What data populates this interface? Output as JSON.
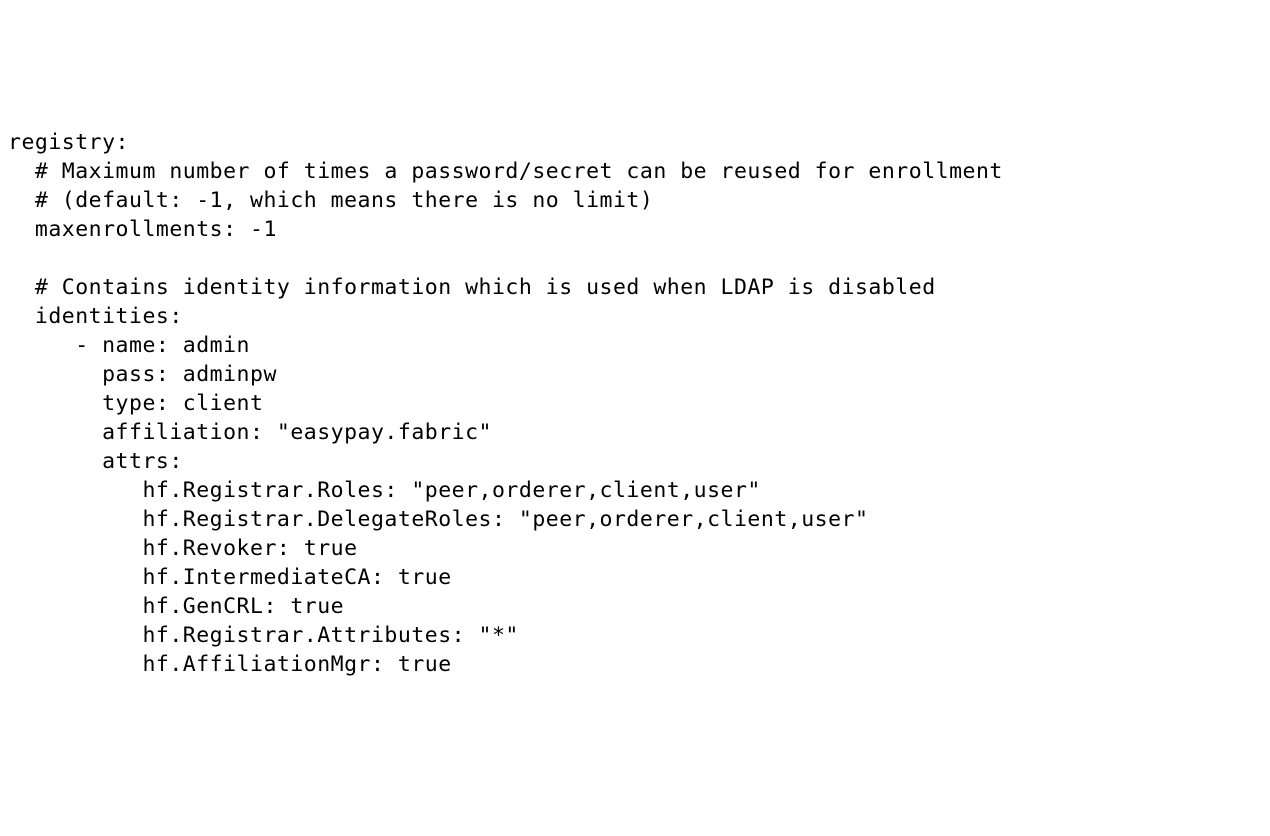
{
  "lines": {
    "l1": "registry:",
    "l2": "  # Maximum number of times a password/secret can be reused for enrollment",
    "l3": "  # (default: -1, which means there is no limit)",
    "l4": "  maxenrollments: -1",
    "l5": "",
    "l6": "  # Contains identity information which is used when LDAP is disabled",
    "l7": "  identities:",
    "l8": "     - name: admin",
    "l9": "       pass: adminpw",
    "l10": "       type: client",
    "l11": "       affiliation: \"easypay.fabric\"",
    "l12": "       attrs:",
    "l13": "          hf.Registrar.Roles: \"peer,orderer,client,user\"",
    "l14": "          hf.Registrar.DelegateRoles: \"peer,orderer,client,user\"",
    "l15": "          hf.Revoker: true",
    "l16": "          hf.IntermediateCA: true",
    "l17": "          hf.GenCRL: true",
    "l18": "          hf.Registrar.Attributes: \"*\"",
    "l19": "          hf.AffiliationMgr: true"
  }
}
